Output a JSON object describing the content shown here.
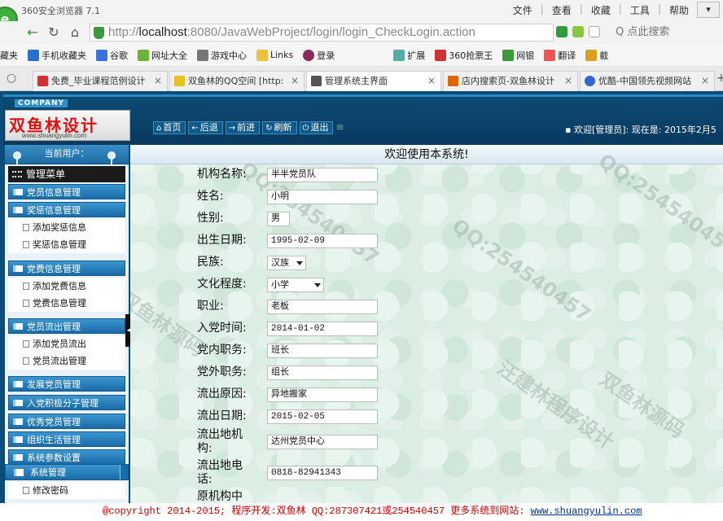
{
  "browser": {
    "title": "360安全浏览器 7.1",
    "menus": [
      "文件",
      "查看",
      "收藏",
      "工具",
      "帮助"
    ],
    "url_prefix": "http://",
    "url_host": "localhost",
    "url_rest": ":8080/JavaWebProject/login/login_CheckLogin.action",
    "search_placeholder": "点此搜索",
    "favorites": [
      "藏夹",
      "手机收藏夹",
      "谷歌",
      "网址大全",
      "游戏中心",
      "Links",
      "登录",
      "扩展",
      "360抢票王",
      "网银",
      "翻译",
      "截"
    ],
    "tabs": [
      {
        "label": "免费_毕业课程范例设计",
        "color": "#c33",
        "active": false
      },
      {
        "label": "双鱼林的QQ空间 [http:",
        "color": "#e8c020",
        "active": false
      },
      {
        "label": "管理系统主界面",
        "color": "#555",
        "active": true
      },
      {
        "label": "店内搜索页-双鱼林设计",
        "color": "#d60",
        "active": false
      },
      {
        "label": "优酷-中国领先视频网站",
        "color": "#36c",
        "active": false
      }
    ]
  },
  "header": {
    "company": "COMPANY",
    "brand": "双鱼林设计",
    "brand_url": "www.shuangyulin.com",
    "nav": [
      {
        "icon": "home-icon",
        "glyph": "⌂",
        "label": "首页"
      },
      {
        "icon": "back-icon",
        "glyph": "←",
        "label": "后退"
      },
      {
        "icon": "forward-icon",
        "glyph": "→",
        "label": "前进"
      },
      {
        "icon": "refresh-icon",
        "glyph": "↻",
        "label": "刷新"
      },
      {
        "icon": "power-icon",
        "glyph": "⏻",
        "label": "退出"
      }
    ],
    "welcome": "欢迎[管理员]: 现在是: 2015年2月5"
  },
  "sidebar": {
    "current_user": "当前用户：",
    "menu_title": "管理菜单",
    "sections": [
      {
        "label": "党员信息管理",
        "items": []
      },
      {
        "label": "奖惩信息管理",
        "items": [
          "添加奖惩信息",
          "奖惩信息管理"
        ]
      },
      {
        "label": "党费信息管理",
        "items": [
          "添加党费信息",
          "党费信息管理"
        ]
      },
      {
        "label": "党员流出管理",
        "items": [
          "添加党员流出",
          "党员流出管理"
        ]
      },
      {
        "label": "发展党员管理",
        "items": []
      },
      {
        "label": "入党积极分子管理",
        "items": []
      },
      {
        "label": "优秀党员管理",
        "items": []
      },
      {
        "label": "组织生活管理",
        "items": []
      },
      {
        "label": "系统参数设置",
        "items": []
      }
    ],
    "system": "系统管理",
    "system_items": [
      "修改密码"
    ]
  },
  "main": {
    "heading": "欢迎使用本系统!",
    "fields": [
      {
        "label": "机构名称:",
        "value": "半半党员队",
        "type": "input"
      },
      {
        "label": "姓名:",
        "value": "小明",
        "type": "input"
      },
      {
        "label": "性别:",
        "value": "男",
        "type": "input-small"
      },
      {
        "label": "出生日期:",
        "value": "1995-02-09",
        "type": "input"
      },
      {
        "label": "民族:",
        "value": "汉族",
        "type": "select"
      },
      {
        "label": "文化程度:",
        "value": "小学",
        "type": "select-wide"
      },
      {
        "label": "职业:",
        "value": "老板",
        "type": "input"
      },
      {
        "label": "入党时间:",
        "value": "2014-01-02",
        "type": "input"
      },
      {
        "label": "党内职务:",
        "value": "班长",
        "type": "input"
      },
      {
        "label": "党外职务:",
        "value": "组长",
        "type": "input"
      },
      {
        "label": "流出原因:",
        "value": "异地搬家",
        "type": "input"
      },
      {
        "label": "流出日期:",
        "value": "2015-02-05",
        "type": "input"
      },
      {
        "label_line1": "流出地机",
        "label_line2": "构:",
        "value": "达州党员中心",
        "type": "input"
      },
      {
        "label_line1": "流出地电",
        "label_line2": "话:",
        "value": "0818-82941343",
        "type": "input"
      },
      {
        "label": "原机构中",
        "type": "partial"
      }
    ]
  },
  "footer": {
    "copyright": "@copyright 2014-2015; 程序开发:双鱼林  QQ:287307421或254540457  更多系统到网站: ",
    "site": "www.shuangyulin.com"
  },
  "watermarks": [
    "QQ:254540457",
    "双鱼林源码",
    "汪建林程序设计"
  ]
}
